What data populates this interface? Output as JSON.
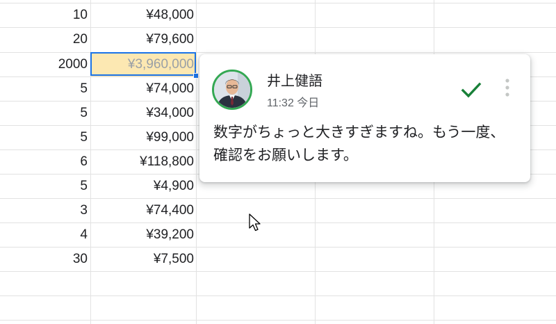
{
  "sheet": {
    "rows": [
      {
        "qty": "10",
        "amount": "¥48,000"
      },
      {
        "qty": "20",
        "amount": "¥79,600"
      },
      {
        "qty": "2000",
        "amount": "¥3,960,000"
      },
      {
        "qty": "5",
        "amount": "¥74,000"
      },
      {
        "qty": "5",
        "amount": "¥34,000"
      },
      {
        "qty": "5",
        "amount": "¥99,000"
      },
      {
        "qty": "6",
        "amount": "¥118,800"
      },
      {
        "qty": "5",
        "amount": "¥4,900"
      },
      {
        "qty": "3",
        "amount": "¥74,400"
      },
      {
        "qty": "4",
        "amount": "¥39,200"
      },
      {
        "qty": "30",
        "amount": "¥7,500"
      }
    ],
    "selected_row": 2,
    "commented_row": 2
  },
  "comment": {
    "author": "井上健語",
    "timestamp": "11:32 今日",
    "body": "数字がちょっと大きすぎますね。もう一度、確認をお願いします。",
    "avatar_ring_color": "#34a853",
    "resolve_icon": "checkmark-icon",
    "more_icon": "more-vert-icon",
    "resolve_color": "#188038"
  },
  "colors": {
    "selection": "#1a73e8",
    "comment_highlight": "#fce8b2",
    "grid": "#e2e2e2"
  }
}
